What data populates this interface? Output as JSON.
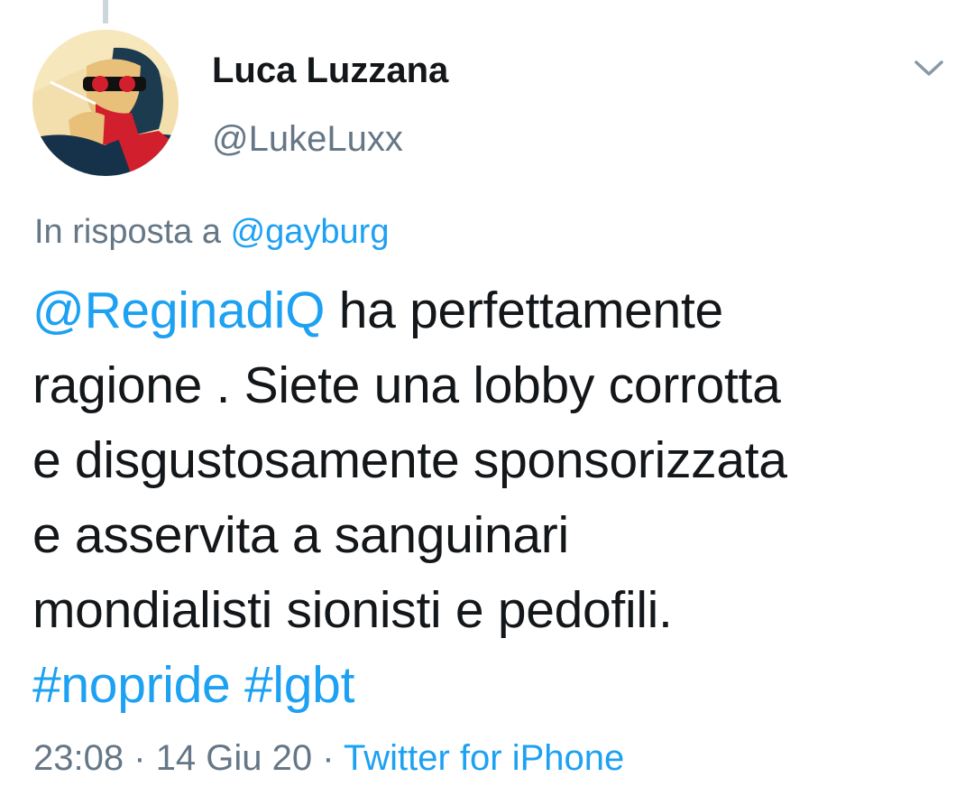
{
  "author": {
    "display_name": "Luca Luzzana",
    "handle": "@LukeLuxx"
  },
  "icons": {
    "menu": "chevron-down-icon",
    "avatar": "avatar-image"
  },
  "reply": {
    "prefix": "In risposta a",
    "to": "@gayburg"
  },
  "tweet": {
    "mention": "@ReginadiQ",
    "line1_rest": " ha perfettamente",
    "line2": "ragione . Siete una lobby corrotta",
    "line3": "e disgustosamente sponsorizzata",
    "line4": "e asservita a sanguinari",
    "line5": "mondialisti sionisti e pedofili.",
    "hashtag1": "#nopride",
    "hashtag2": "#lgbt"
  },
  "meta": {
    "time": "23:08",
    "date": "14 Giu 20",
    "separator": "·",
    "source": "Twitter for iPhone"
  },
  "colors": {
    "link": "#1da1f2",
    "secondary_text": "#657786",
    "primary_text": "#14171a"
  }
}
